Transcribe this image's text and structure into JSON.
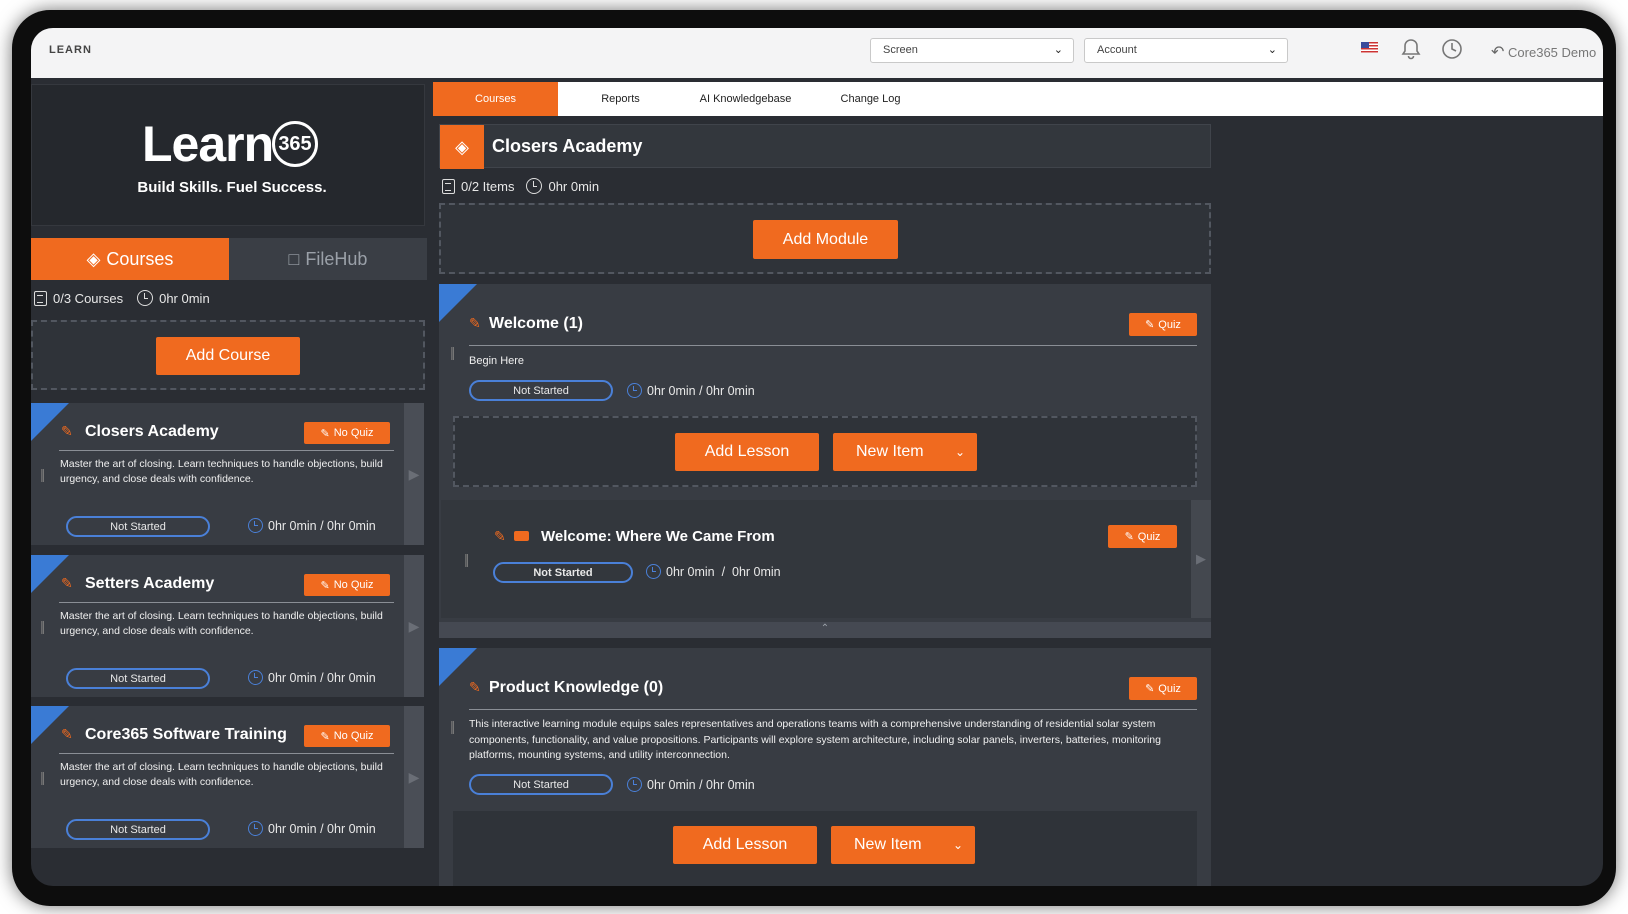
{
  "topbar": {
    "app_title": "LEARN",
    "screen_select": "Screen",
    "account_select": "Account",
    "user_name": "Core365 Demo"
  },
  "sidebar": {
    "logo_word": "Learn",
    "logo_mark": "365",
    "tagline": "Build Skills. Fuel Success.",
    "tabs": [
      {
        "label": "Courses",
        "active": true
      },
      {
        "label": "FileHub",
        "active": false
      }
    ],
    "courses_count": "0/3 Courses",
    "courses_time": "0hr 0min",
    "add_course_label": "Add Course",
    "courses": [
      {
        "title": "Closers Academy",
        "quiz_label": "No Quiz",
        "description": "Master the art of closing. Learn techniques to handle objections, build urgency, and close deals with confidence.",
        "status": "Not Started",
        "time": "0hr 0min / 0hr 0min"
      },
      {
        "title": "Setters Academy",
        "quiz_label": "No Quiz",
        "description": "Master the art of closing. Learn techniques to handle objections, build urgency, and close deals with confidence.",
        "status": "Not Started",
        "time": "0hr 0min / 0hr 0min"
      },
      {
        "title": "Core365 Software Training",
        "quiz_label": "No Quiz",
        "description": "Master the art of closing. Learn techniques to handle objections, build urgency, and close deals with confidence.",
        "status": "Not Started",
        "time": "0hr 0min / 0hr 0min"
      }
    ]
  },
  "main": {
    "tabs": [
      {
        "label": "Courses",
        "active": true
      },
      {
        "label": "Reports",
        "active": false
      },
      {
        "label": "AI Knowledgebase",
        "active": false
      },
      {
        "label": "Change Log",
        "active": false
      }
    ],
    "course_title": "Closers Academy",
    "items_count": "0/2 Items",
    "items_time": "0hr 0min",
    "add_module_label": "Add Module",
    "modules": [
      {
        "title": "Welcome (1)",
        "quiz_label": "Quiz",
        "description": "Begin Here",
        "status": "Not Started",
        "time": "0hr 0min / 0hr 0min",
        "add_lesson_label": "Add Lesson",
        "new_item_label": "New Item",
        "lessons": [
          {
            "title": "Welcome: Where We Came From",
            "quiz_label": "Quiz",
            "status": "Not Started",
            "time": "0hr 0min  /  0hr 0min"
          }
        ]
      },
      {
        "title": "Product Knowledge (0)",
        "quiz_label": "Quiz",
        "description": "This interactive learning module equips sales representatives and operations teams with a comprehensive understanding of residential solar system components, functionality, and value propositions. Participants will explore system architecture, including solar panels, inverters, batteries, monitoring platforms, mounting systems, and utility interconnection.",
        "status": "Not Started",
        "time": "0hr 0min / 0hr 0min",
        "add_lesson_label": "Add Lesson",
        "new_item_label": "New Item"
      }
    ]
  },
  "colors": {
    "accent": "#f06a1f",
    "blue": "#4a80d8",
    "panel": "#383c43",
    "background": "#2a2d33"
  }
}
